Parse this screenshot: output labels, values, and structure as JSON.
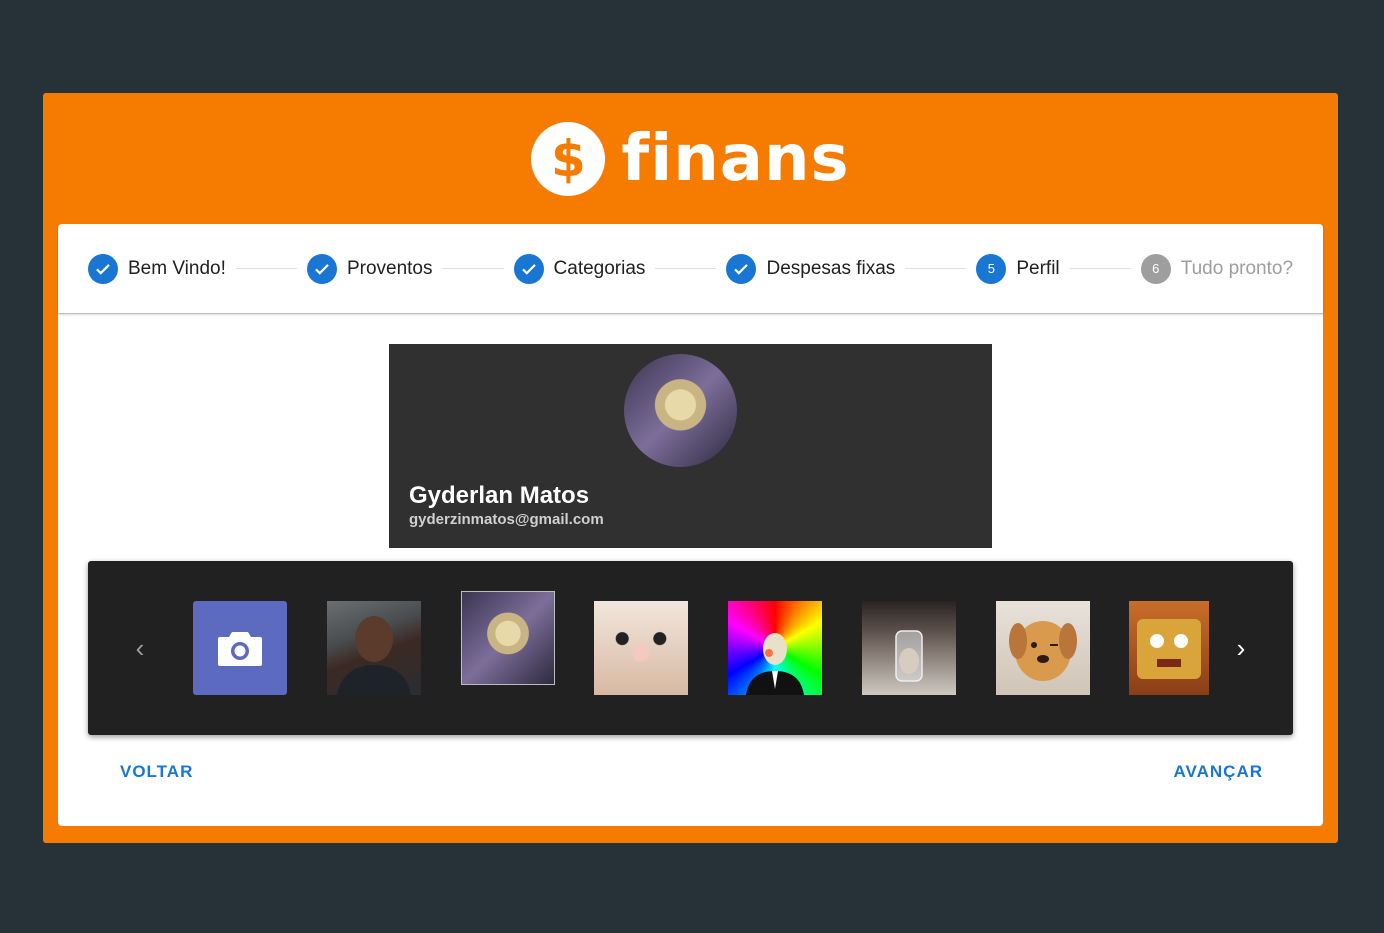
{
  "brand": {
    "name": "finans",
    "coin_symbol": "$"
  },
  "stepper": {
    "steps": [
      {
        "label": "Bem Vindo!",
        "state": "done"
      },
      {
        "label": "Proventos",
        "state": "done"
      },
      {
        "label": "Categorias",
        "state": "done"
      },
      {
        "label": "Despesas fixas",
        "state": "done"
      },
      {
        "label": "Perfil",
        "state": "active",
        "number": "5"
      },
      {
        "label": "Tudo pronto?",
        "state": "pending",
        "number": "6"
      }
    ]
  },
  "profile": {
    "name": "Gyderlan Matos",
    "email": "gyderzinmatos@gmail.com"
  },
  "carousel": {
    "camera_icon": "camera-icon",
    "images": [
      "man-photo",
      "duck-photo",
      "cat-photo",
      "rainbow-bird-photo",
      "glass-photo",
      "puppy-photo",
      "sponge-photo"
    ],
    "selected": "duck-photo"
  },
  "actions": {
    "back_label": "VOLTAR",
    "next_label": "AVANÇAR"
  },
  "colors": {
    "accent": "#f57c00",
    "primary": "#1976d2",
    "background": "#263238"
  }
}
